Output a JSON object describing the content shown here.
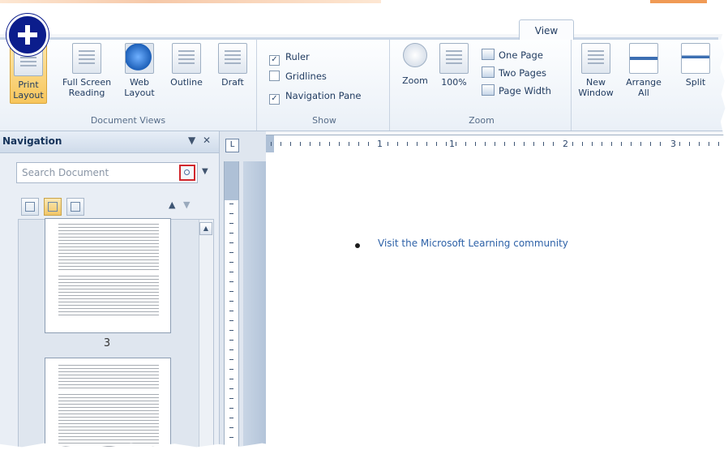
{
  "ribbon": {
    "active_tab": "View",
    "groups": {
      "document_views": {
        "label": "Document Views",
        "buttons": [
          {
            "line1": "Print",
            "line2": "Layout",
            "active": true
          },
          {
            "line1": "Full Screen",
            "line2": "Reading"
          },
          {
            "line1": "Web",
            "line2": "Layout"
          },
          {
            "line1": "Outline",
            "line2": ""
          },
          {
            "line1": "Draft",
            "line2": ""
          }
        ]
      },
      "show": {
        "label": "Show",
        "ruler": {
          "label": "Ruler",
          "checked": true
        },
        "gridlines": {
          "label": "Gridlines",
          "checked": false
        },
        "navigation_pane": {
          "label": "Navigation Pane",
          "checked": true
        }
      },
      "zoom": {
        "label": "Zoom",
        "zoom": "Zoom",
        "percent": "100%",
        "one_page": "One Page",
        "two_pages": "Two Pages",
        "page_width": "Page Width"
      },
      "window": {
        "new_window": {
          "line1": "New",
          "line2": "Window"
        },
        "arrange_all": {
          "line1": "Arrange",
          "line2": "All"
        },
        "split": "Split"
      }
    }
  },
  "navigation": {
    "title": "Navigation",
    "dropdown_glyph": "▼",
    "close_glyph": "✕",
    "search_placeholder": "Search Document",
    "thumbnail_page": "3"
  },
  "document": {
    "bullet_text": "Visit the Microsoft Learning community"
  },
  "ruler": {
    "corner_glyph": "L",
    "marks": [
      "1",
      "1",
      "2",
      "3"
    ]
  },
  "colors": {
    "accent": "#f09a55",
    "ribbon_active": "#f7c65c",
    "link": "#2e62a8",
    "plus_badge": "#0b1d8c"
  }
}
